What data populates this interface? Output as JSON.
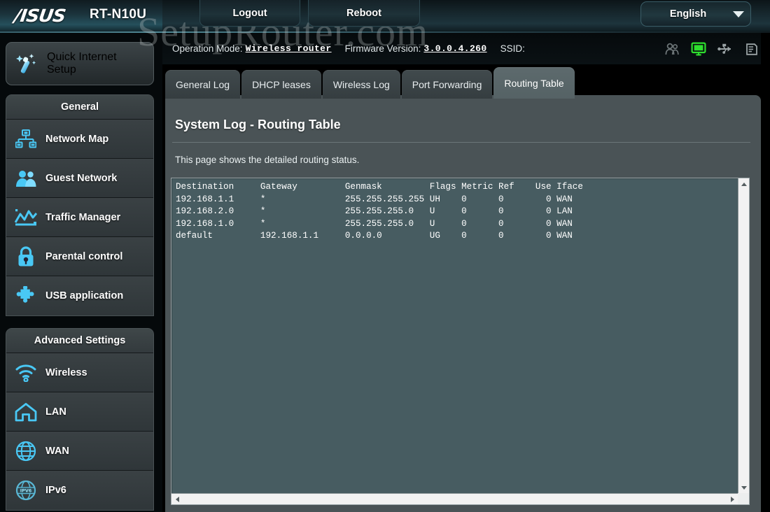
{
  "header": {
    "brand": "/ISUS",
    "model": "RT-N10U",
    "logout_label": "Logout",
    "reboot_label": "Reboot",
    "language_label": "English",
    "language_caret_icon": "chevron-down-icon",
    "watermark": "SetupRouter.com"
  },
  "info_bar": {
    "operation_mode_label": "Operation Mode:",
    "operation_mode_value": "Wireless router",
    "firmware_label": "Firmware Version:",
    "firmware_value": "3.0.0.4.260",
    "ssid_label": "SSID:",
    "ssid_value": "",
    "status_icons": [
      {
        "name": "guest-clients-icon",
        "state": "inactive",
        "color": "#6d7678"
      },
      {
        "name": "connected-client-monitor-icon",
        "state": "active",
        "color": "#2ee02e"
      },
      {
        "name": "usb-icon",
        "state": "inactive",
        "color": "#9aa3a5"
      },
      {
        "name": "printer-icon",
        "state": "inactive",
        "color": "#9aa3a5"
      }
    ]
  },
  "sidebar": {
    "quick_setup": {
      "label_line1": "Quick Internet",
      "label_line2": "Setup",
      "icon": "magic-wand-icon"
    },
    "groups": [
      {
        "title": "General",
        "items": [
          {
            "label": "Network Map",
            "icon": "network-map-icon"
          },
          {
            "label": "Guest Network",
            "icon": "guest-network-icon"
          },
          {
            "label": "Traffic Manager",
            "icon": "traffic-manager-icon"
          },
          {
            "label": "Parental control",
            "icon": "lock-icon"
          },
          {
            "label": "USB application",
            "icon": "puzzle-piece-icon"
          }
        ]
      },
      {
        "title": "Advanced Settings",
        "items": [
          {
            "label": "Wireless",
            "icon": "wifi-icon"
          },
          {
            "label": "LAN",
            "icon": "house-icon"
          },
          {
            "label": "WAN",
            "icon": "globe-icon"
          },
          {
            "label": "IPv6",
            "icon": "ipv6-globe-icon"
          }
        ]
      }
    ]
  },
  "tabs": [
    {
      "label": "General Log",
      "active": false
    },
    {
      "label": "DHCP leases",
      "active": false
    },
    {
      "label": "Wireless Log",
      "active": false
    },
    {
      "label": "Port Forwarding",
      "active": false
    },
    {
      "label": "Routing Table",
      "active": true
    }
  ],
  "main": {
    "title": "System Log - Routing Table",
    "description": "This page shows the detailed routing status.",
    "routing_table": {
      "columns": [
        "Destination",
        "Gateway",
        "Genmask",
        "Flags",
        "Metric",
        "Ref",
        "Use",
        "Iface"
      ],
      "rows": [
        [
          "192.168.1.1",
          "*",
          "255.255.255.255",
          "UH",
          "0",
          "0",
          "0",
          "WAN"
        ],
        [
          "192.168.2.0",
          "*",
          "255.255.255.0",
          "U",
          "0",
          "0",
          "0",
          "LAN"
        ],
        [
          "192.168.1.0",
          "*",
          "255.255.255.0",
          "U",
          "0",
          "0",
          "0",
          "WAN"
        ],
        [
          "default",
          "192.168.1.1",
          "0.0.0.0",
          "UG",
          "0",
          "0",
          "0",
          "WAN"
        ]
      ],
      "raw_text": "Destination     Gateway         Genmask         Flags Metric Ref    Use Iface\n192.168.1.1     *               255.255.255.255 UH    0      0        0 WAN\n192.168.2.0     *               255.255.255.0   U     0      0        0 LAN\n192.168.1.0     *               255.255.255.0   U     0      0        0 WAN\ndefault         192.168.1.1     0.0.0.0         UG    0      0        0 WAN"
    },
    "scrollbars": {
      "vertical_up_icon": "arrow-up-icon",
      "vertical_down_icon": "arrow-down-icon",
      "horizontal_left_icon": "arrow-left-icon",
      "horizontal_right_icon": "arrow-right-icon"
    }
  },
  "colors": {
    "panel_bg": "#4a5356",
    "log_bg": "#475c61",
    "accent_cyan": "#49c8f5",
    "active_tab": "#5d6a6d",
    "status_active_green": "#2ee02e"
  }
}
